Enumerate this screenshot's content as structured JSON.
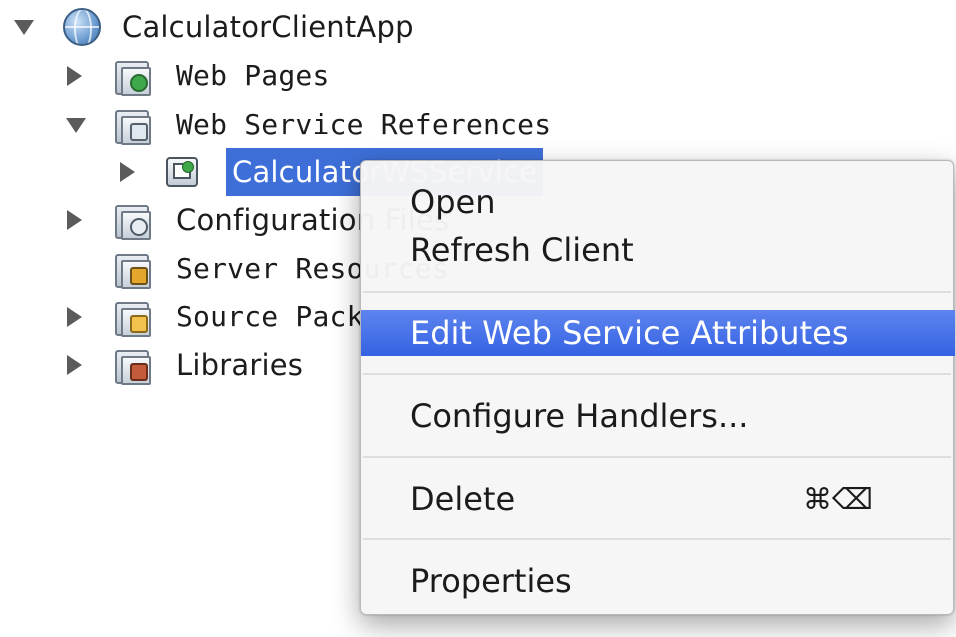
{
  "tree": {
    "root": {
      "label": "CalculatorClientApp",
      "icon": "globe-icon",
      "expanded": true
    },
    "items": [
      {
        "label": "Web Pages",
        "icon": "web-pages-folder-icon",
        "expanded": false
      },
      {
        "label": "Web Service References",
        "icon": "web-service-folder-icon",
        "expanded": true
      },
      {
        "label": "CalculatorWSService",
        "icon": "web-service-icon",
        "expanded": false,
        "selected": true
      },
      {
        "label": "Configuration Files",
        "icon": "config-folder-icon",
        "expanded": false
      },
      {
        "label": "Server Resources",
        "icon": "server-folder-icon"
      },
      {
        "label": "Source Packages",
        "icon": "source-folder-icon",
        "expanded": false
      },
      {
        "label": "Libraries",
        "icon": "library-folder-icon",
        "expanded": false
      }
    ]
  },
  "context_menu": {
    "items": [
      {
        "label": "Open"
      },
      {
        "label": "Refresh Client"
      },
      {
        "label": "Edit Web Service Attributes",
        "highlighted": true
      },
      {
        "label": "Configure Handlers..."
      },
      {
        "label": "Delete",
        "shortcut": "⌘⌫"
      },
      {
        "label": "Properties"
      }
    ]
  },
  "colors": {
    "selection": "#3e6fd8",
    "menu_highlight": "#3562e3",
    "menu_background": "#f6f6f6"
  }
}
